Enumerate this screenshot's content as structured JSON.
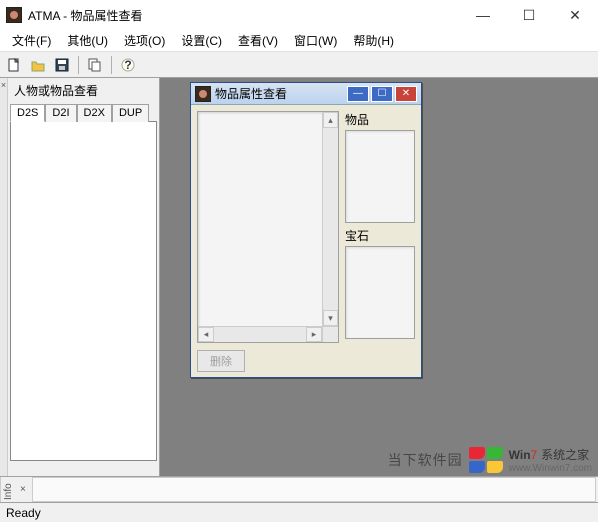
{
  "window": {
    "title": "ATMA - 物品属性查看",
    "controls": {
      "min": "—",
      "max": "☐",
      "close": "✕"
    }
  },
  "menu": {
    "file": "文件(F)",
    "other": "其他(U)",
    "options": "选项(O)",
    "settings": "设置(C)",
    "view": "查看(V)",
    "window": "窗口(W)",
    "help": "帮助(H)"
  },
  "toolbar": {
    "new": "new-icon",
    "open": "open-icon",
    "save": "save-icon",
    "copy": "copy-icon",
    "help": "help-icon"
  },
  "left_panel": {
    "title": "人物或物品查看",
    "tabs": [
      "D2S",
      "D2I",
      "D2X",
      "DUP"
    ]
  },
  "child_window": {
    "title": "物品属性查看",
    "right_labels": {
      "items": "物品",
      "gems": "宝石"
    },
    "delete_button": "删除"
  },
  "info_tab": "Info",
  "status": "Ready",
  "watermark": {
    "brand": "当下软件园",
    "site": "系统之家",
    "prefix": "Win",
    "suffix": "7",
    "url": "www.Winwin7.com"
  }
}
